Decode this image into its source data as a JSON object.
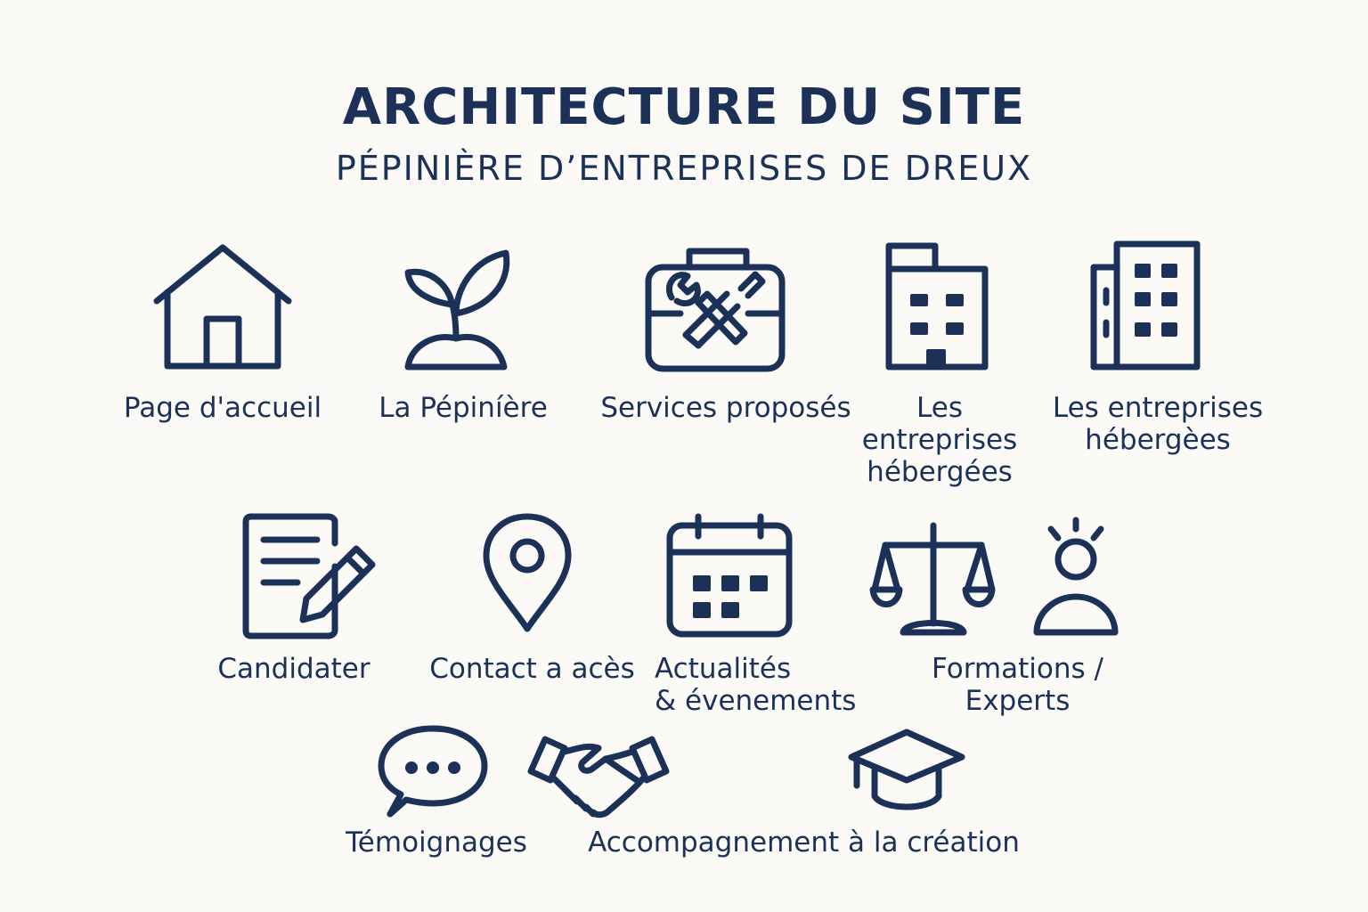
{
  "header": {
    "title": "ARCHITECTURE DU SITE",
    "subtitle": "PÉPINIÈRE D’ENTREPRISES DE DREUX"
  },
  "colors": {
    "background": "#fbfaf7",
    "ink": "#1b3157"
  },
  "items": [
    {
      "label": "Page d'accueil",
      "icon": "house-icon"
    },
    {
      "label": "La Pépiníère",
      "icon": "sprout-icon"
    },
    {
      "label": "Services proposés",
      "icon": "toolbox-icon"
    },
    {
      "label": "Les\nentreprises\nhébergées",
      "icon": "building-icon"
    },
    {
      "label": "Les entreprises\nhébergèes",
      "icon": "office-buildings-icon"
    },
    {
      "label": "Candidater",
      "icon": "document-pencil-icon"
    },
    {
      "label": "Contact a acès",
      "icon": "map-pin-icon"
    },
    {
      "label": "Actualités\n& évenements",
      "icon": "calendar-icon"
    },
    {
      "label": "Formations /\nExperts",
      "icon": "scales-expert-icon"
    },
    {
      "label": "Témoignages",
      "icon": "speech-bubble-icon"
    },
    {
      "label": "Accompagnement à la création",
      "icon": "handshake-graduation-icon"
    }
  ]
}
